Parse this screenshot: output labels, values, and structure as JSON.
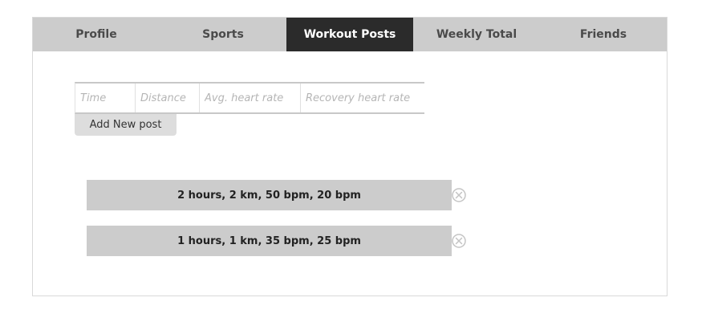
{
  "tabs": [
    {
      "label": "Profile",
      "active": false
    },
    {
      "label": "Sports",
      "active": false
    },
    {
      "label": "Workout Posts",
      "active": true
    },
    {
      "label": "Weekly Total",
      "active": false
    },
    {
      "label": "Friends",
      "active": false
    }
  ],
  "form": {
    "time_placeholder": "Time",
    "distance_placeholder": "Distance",
    "avg_hr_placeholder": "Avg. heart rate",
    "recovery_hr_placeholder": "Recovery heart rate",
    "add_button_label": "Add New post"
  },
  "posts": [
    {
      "text": "2 hours, 2 km, 50 bpm, 20 bpm",
      "remove_icon": "close-circle-icon"
    },
    {
      "text": "1 hours, 1 km, 35 bpm, 25 bpm",
      "remove_icon": "close-circle-icon"
    }
  ],
  "colors": {
    "tab_bar": "#cccccc",
    "active_tab": "#2b2b2b",
    "post_bg": "#cccccc"
  }
}
